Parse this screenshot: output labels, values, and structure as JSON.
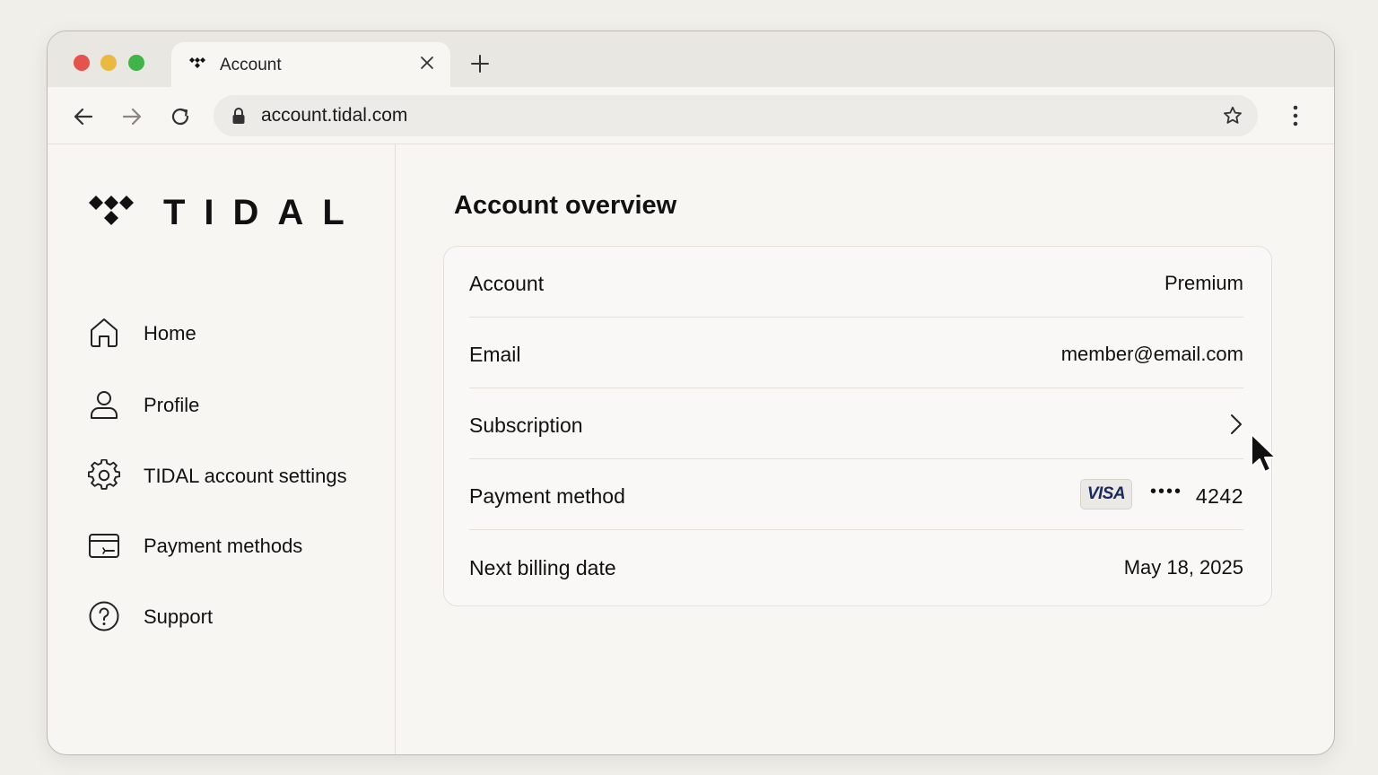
{
  "browser": {
    "tab_title": "Account",
    "url": "account.tidal.com"
  },
  "sidebar": {
    "logo_text": "TIDAL",
    "items": [
      {
        "label": "Home",
        "icon": "home-icon"
      },
      {
        "label": "Profile",
        "icon": "user-icon"
      },
      {
        "label": "TIDAL account settings",
        "icon": "gear-icon"
      },
      {
        "label": "Payment methods",
        "icon": "card-icon"
      },
      {
        "label": "Support",
        "icon": "help-icon"
      }
    ]
  },
  "main": {
    "title": "Account overview",
    "rows": {
      "account": {
        "label": "Account",
        "value": "Premium"
      },
      "email": {
        "label": "Email",
        "value": "member@email.com"
      },
      "subscription": {
        "label": "Subscription"
      },
      "payment": {
        "label": "Payment method",
        "card_brand": "VISA",
        "masked": "••••",
        "last4": "4242"
      },
      "billing": {
        "label": "Next billing date",
        "value": "May 18, 2025"
      }
    }
  },
  "colors": {
    "page_bg": "#f1efea",
    "window_bg": "#f7f6f3",
    "close_red": "#e5534b",
    "minimize_yellow": "#e9b940",
    "maximize_green": "#3fb548",
    "visa_blue": "#1b2a5c"
  }
}
